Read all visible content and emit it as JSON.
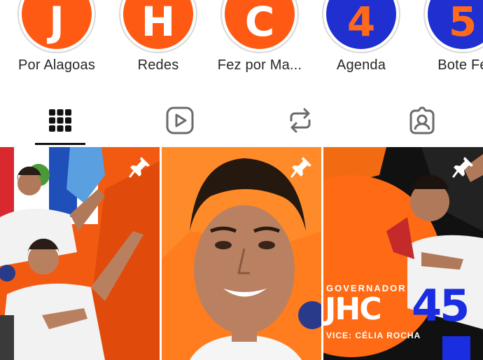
{
  "highlights": [
    {
      "letter": "J",
      "label": "Por Alagoas",
      "style": "orange"
    },
    {
      "letter": "H",
      "label": "Redes",
      "style": "orange"
    },
    {
      "letter": "C",
      "label": "Fez por Ma...",
      "style": "orange"
    },
    {
      "letter": "4",
      "label": "Agenda",
      "style": "blue"
    },
    {
      "letter": "5",
      "label": "Bote Fé",
      "style": "blue"
    }
  ],
  "tabs": [
    {
      "icon": "grid-icon",
      "active": true
    },
    {
      "icon": "reels-icon",
      "active": false
    },
    {
      "icon": "reposts-icon",
      "active": false
    },
    {
      "icon": "tagged-icon",
      "active": false
    }
  ],
  "posts": [
    {
      "pinned": true
    },
    {
      "pinned": true
    },
    {
      "pinned": true,
      "caption_title": "GOVERNADOR",
      "caption_name": "JHC",
      "caption_number": "45",
      "caption_vice": "VICE: CÉLIA ROCHA"
    }
  ],
  "colors": {
    "brand_orange": "#ff5a14",
    "brand_blue": "#1f2fd0"
  }
}
